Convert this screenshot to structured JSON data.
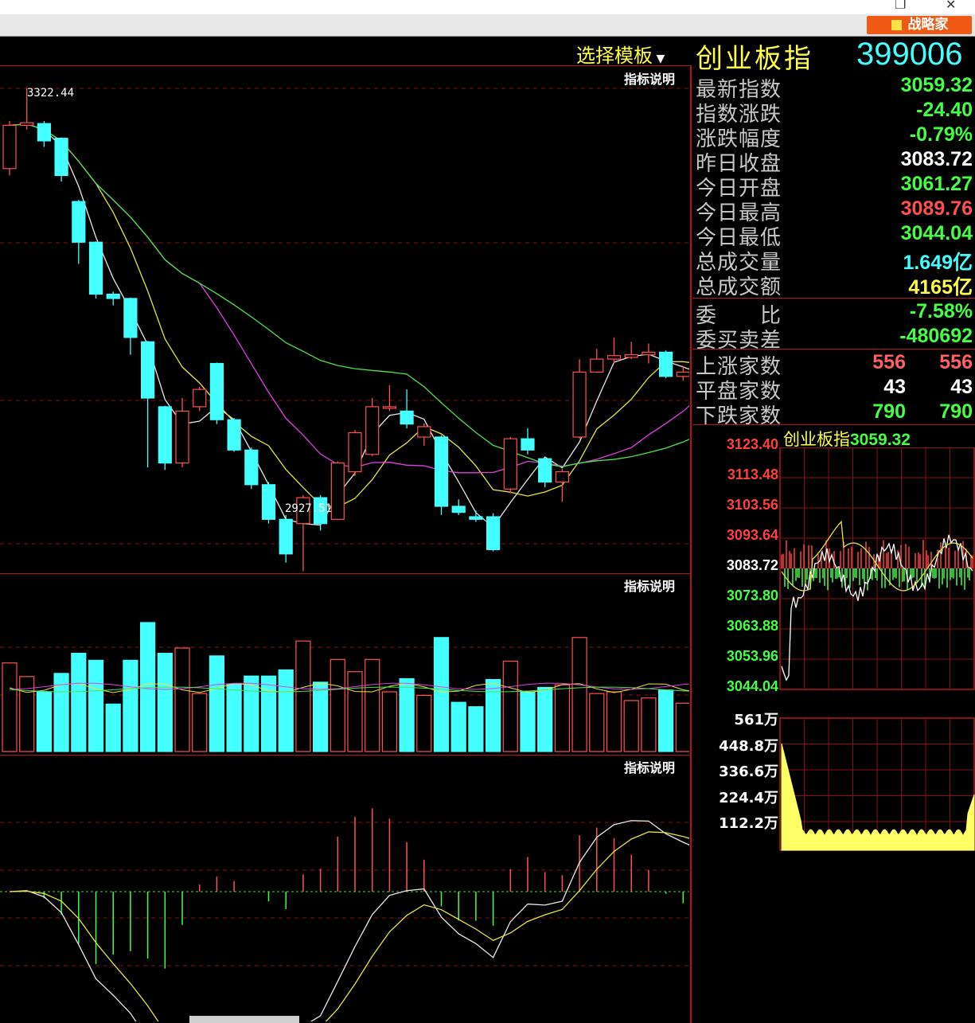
{
  "window": {
    "close_glyph": "✕",
    "restore_glyph": "❐",
    "strategy_button": "战略家"
  },
  "header": {
    "template_select": "选择模板",
    "index_name": "创业板指",
    "index_code": "399006"
  },
  "indicator_help": [
    "指标说明",
    "指标说明",
    "指标说明"
  ],
  "kline": {
    "high_label": "3322.44",
    "low_label": "2927.51"
  },
  "stats": [
    {
      "label": "最新指数",
      "value": "3059.32",
      "color": "#44ff44"
    },
    {
      "label": "指数涨跌",
      "value": "-24.40",
      "color": "#44ff44"
    },
    {
      "label": "涨跌幅度",
      "value": "-0.79%",
      "color": "#44ff44"
    },
    {
      "label": "昨日收盘",
      "value": "3083.72",
      "color": "#ffffff"
    },
    {
      "label": "今日开盘",
      "value": "3061.27",
      "color": "#44ff44"
    },
    {
      "label": "今日最高",
      "value": "3089.76",
      "color": "#ff5050"
    },
    {
      "label": "今日最低",
      "value": "3044.04",
      "color": "#44ff44"
    },
    {
      "label": "总成交量",
      "value": "1.649亿",
      "color": "#44ffff"
    },
    {
      "label": "总成交额",
      "value": "4165亿",
      "color": "#ffff44"
    }
  ],
  "ratio": [
    {
      "label": "委　　比",
      "value": "-7.58%",
      "color": "#44ff44"
    },
    {
      "label": "委买卖差",
      "value": "-480692",
      "color": "#44ff44"
    }
  ],
  "breadth": [
    {
      "label": "上涨家数",
      "v1": "556",
      "v2": "556",
      "color": "#ff6060"
    },
    {
      "label": "平盘家数",
      "v1": "43",
      "v2": "43",
      "color": "#ffffff"
    },
    {
      "label": "下跌家数",
      "v1": "790",
      "v2": "790",
      "color": "#44ff44"
    }
  ],
  "intraday": {
    "title_name": "创业板指",
    "title_value": "3059.32",
    "price_ticks": [
      {
        "v": "3123.40",
        "color": "#ff4040"
      },
      {
        "v": "3113.48",
        "color": "#ff4040"
      },
      {
        "v": "3103.56",
        "color": "#ff4040"
      },
      {
        "v": "3093.64",
        "color": "#ff4040"
      },
      {
        "v": "3083.72",
        "color": "#ffffff"
      },
      {
        "v": "3073.80",
        "color": "#44ff44"
      },
      {
        "v": "3063.88",
        "color": "#44ff44"
      },
      {
        "v": "3053.96",
        "color": "#44ff44"
      },
      {
        "v": "3044.04",
        "color": "#44ff44"
      }
    ],
    "volume_ticks": [
      "561万",
      "448.8万",
      "336.6万",
      "224.4万",
      "112.2万"
    ]
  },
  "chart_data": {
    "type": "candlestick",
    "candles": [
      {
        "o": 3230,
        "c": 3280,
        "h": 3285,
        "l": 3222
      },
      {
        "o": 3280,
        "c": 3283,
        "h": 3322.44,
        "l": 3275
      },
      {
        "o": 3282,
        "c": 3262,
        "h": 3285,
        "l": 3255
      },
      {
        "o": 3265,
        "c": 3222,
        "h": 3266,
        "l": 3215
      },
      {
        "o": 3192,
        "c": 3145,
        "h": 3194,
        "l": 3120
      },
      {
        "o": 3145,
        "c": 3085,
        "h": 3146,
        "l": 3080
      },
      {
        "o": 3085,
        "c": 3080,
        "h": 3088,
        "l": 3072
      },
      {
        "o": 3080,
        "c": 3035,
        "h": 3081,
        "l": 3015
      },
      {
        "o": 3030,
        "c": 2965,
        "h": 3031,
        "l": 2885
      },
      {
        "o": 2955,
        "c": 2890,
        "h": 2956,
        "l": 2882
      },
      {
        "o": 2890,
        "c": 2950,
        "h": 2965,
        "l": 2885
      },
      {
        "o": 2955,
        "c": 2975,
        "h": 2978,
        "l": 2950
      },
      {
        "o": 3005,
        "c": 2940,
        "h": 3006,
        "l": 2935
      },
      {
        "o": 2940,
        "c": 2905,
        "h": 2942,
        "l": 2903
      },
      {
        "o": 2905,
        "c": 2865,
        "h": 2908,
        "l": 2860
      },
      {
        "o": 2865,
        "c": 2825,
        "h": 2868,
        "l": 2820
      },
      {
        "o": 2825,
        "c": 2785,
        "h": 2830,
        "l": 2775
      },
      {
        "o": 2820,
        "c": 2850,
        "h": 2853,
        "l": 2765
      },
      {
        "o": 2850,
        "c": 2820,
        "h": 2853,
        "l": 2812
      },
      {
        "o": 2825,
        "c": 2890,
        "h": 2892,
        "l": 2825
      },
      {
        "o": 2880,
        "c": 2925,
        "h": 2928,
        "l": 2875
      },
      {
        "o": 2900,
        "c": 2955,
        "h": 2965,
        "l": 2898
      },
      {
        "o": 2955,
        "c": 2955,
        "h": 2980,
        "l": 2950
      },
      {
        "o": 2950,
        "c": 2935,
        "h": 2975,
        "l": 2930
      },
      {
        "o": 2920,
        "c": 2932,
        "h": 2936,
        "l": 2910
      },
      {
        "o": 2920,
        "c": 2840,
        "h": 2922,
        "l": 2830
      },
      {
        "o": 2840,
        "c": 2833,
        "h": 2848,
        "l": 2830
      },
      {
        "o": 2828,
        "c": 2825,
        "h": 2835,
        "l": 2822
      },
      {
        "o": 2828,
        "c": 2790,
        "h": 2832,
        "l": 2788
      },
      {
        "o": 2860,
        "c": 2918,
        "h": 2920,
        "l": 2855
      },
      {
        "o": 2918,
        "c": 2905,
        "h": 2930,
        "l": 2900
      },
      {
        "o": 2895,
        "c": 2868,
        "h": 2897,
        "l": 2862
      },
      {
        "o": 2868,
        "c": 2880,
        "h": 2883,
        "l": 2845
      },
      {
        "o": 2920,
        "c": 2995,
        "h": 3010,
        "l": 2918
      },
      {
        "o": 2995,
        "c": 3010,
        "h": 3022,
        "l": 2994
      },
      {
        "o": 3010,
        "c": 3014,
        "h": 3035,
        "l": 3005
      },
      {
        "o": 3012,
        "c": 3015,
        "h": 3030,
        "l": 3010
      },
      {
        "o": 3015,
        "c": 3018,
        "h": 3028,
        "l": 3005
      },
      {
        "o": 3018,
        "c": 2990,
        "h": 3020,
        "l": 2988
      },
      {
        "o": 2990,
        "c": 2995,
        "h": 3002,
        "l": 2985
      },
      {
        "o": 2995,
        "c": 2995,
        "h": 2998,
        "l": 2990
      }
    ],
    "ylim": [
      2760,
      3330
    ]
  }
}
